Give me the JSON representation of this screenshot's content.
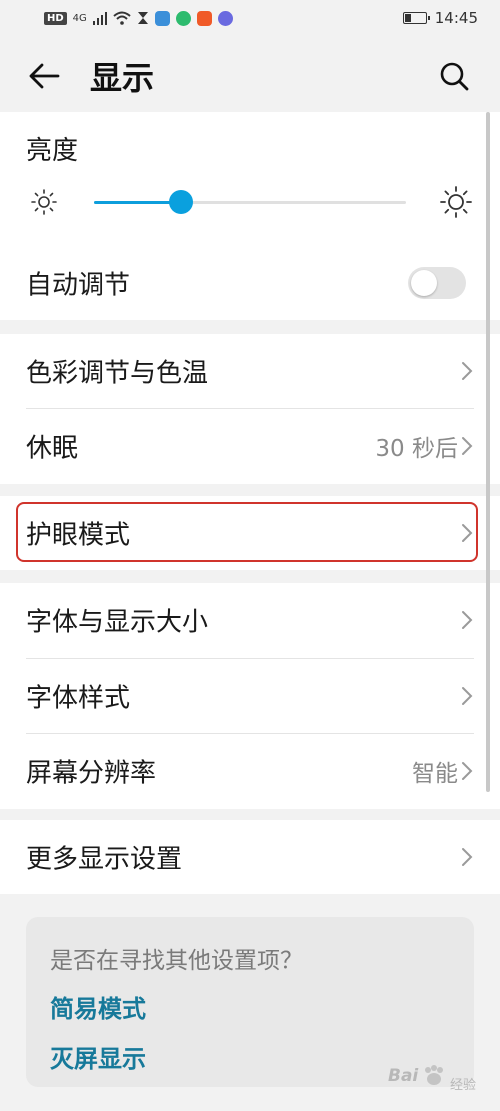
{
  "status_bar": {
    "network_chip": "HD",
    "network_type": "4G",
    "time": "14:45",
    "app_colors": [
      "#3b8fd9",
      "#2dbb6e",
      "#f05a28",
      "#6a6ae0"
    ]
  },
  "header": {
    "title": "显示",
    "back_icon": "back-arrow-icon",
    "search_icon": "search-icon"
  },
  "brightness": {
    "label": "亮度",
    "level": 0.28,
    "accent_color": "#0d9edc"
  },
  "auto_adjust": {
    "label": "自动调节",
    "enabled": false
  },
  "group2": [
    {
      "label": "色彩调节与色温",
      "value": ""
    },
    {
      "label": "休眠",
      "value": "30 秒后"
    }
  ],
  "eye_mode": {
    "label": "护眼模式",
    "highlight_color": "#d0342c"
  },
  "group4": [
    {
      "label": "字体与显示大小",
      "value": ""
    },
    {
      "label": "字体样式",
      "value": ""
    },
    {
      "label": "屏幕分辨率",
      "value": "智能"
    }
  ],
  "more_settings": {
    "label": "更多显示设置"
  },
  "hint_card": {
    "title": "是否在寻找其他设置项？",
    "links": [
      "简易模式",
      "灭屏显示"
    ]
  },
  "watermark": {
    "brand": "Bai",
    "sub": "经验"
  }
}
